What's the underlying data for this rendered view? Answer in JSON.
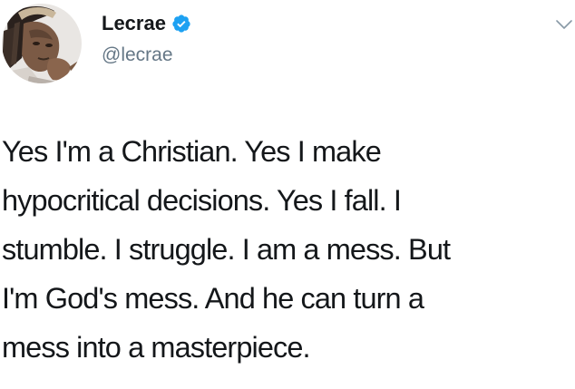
{
  "user": {
    "display_name": "Lecrae",
    "handle": "@lecrae",
    "verified": true,
    "avatar_icon": "user-avatar-photo",
    "verified_color": "#1da1f2"
  },
  "menu": {
    "icon": "chevron-down-icon"
  },
  "tweet": {
    "lines": [
      "Yes I'm a Christian. Yes I make",
      "hypocritical decisions. Yes I fall. I",
      "stumble. I struggle. I am a mess. But",
      "I'm God's mess. And he can turn a",
      "mess into a masterpiece."
    ]
  },
  "colors": {
    "text": "#14171a",
    "secondary": "#657786",
    "background": "#ffffff"
  }
}
